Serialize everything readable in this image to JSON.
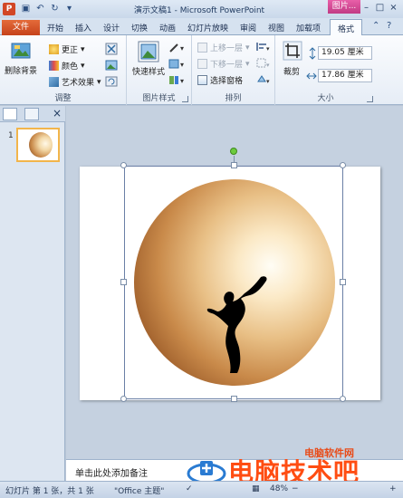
{
  "window": {
    "app_letter": "P",
    "title": "演示文稿1 - Microsoft PowerPoint",
    "context_tab_head": "图片..."
  },
  "tabs": {
    "file": "文件",
    "items": [
      "开始",
      "插入",
      "设计",
      "切换",
      "动画",
      "幻灯片放映",
      "审阅",
      "视图",
      "加载项",
      "格式"
    ]
  },
  "ribbon": {
    "adjust": {
      "remove_bg": "删除背景",
      "corrections": "更正",
      "color": "颜色",
      "art_effects": "艺术效果",
      "label": "调整"
    },
    "picture_styles": {
      "quick_styles": "快速样式",
      "label": "图片样式"
    },
    "arrange": {
      "bring_forward": "上移一层",
      "send_backward": "下移一层",
      "selection_pane": "选择窗格",
      "label": "排列"
    },
    "size": {
      "crop": "裁剪",
      "height": "19.05 厘米",
      "width": "17.86 厘米",
      "label": "大小"
    }
  },
  "slides_panel": {
    "slide_number": "1"
  },
  "notes": {
    "placeholder": "单击此处添加备注"
  },
  "status": {
    "slide_info": "幻灯片 第 1 张，共 1 张",
    "theme": "\"Office 主题\"",
    "zoom": "48%"
  },
  "watermark": {
    "text": "电脑技术吧",
    "url": "电脑软件网"
  }
}
